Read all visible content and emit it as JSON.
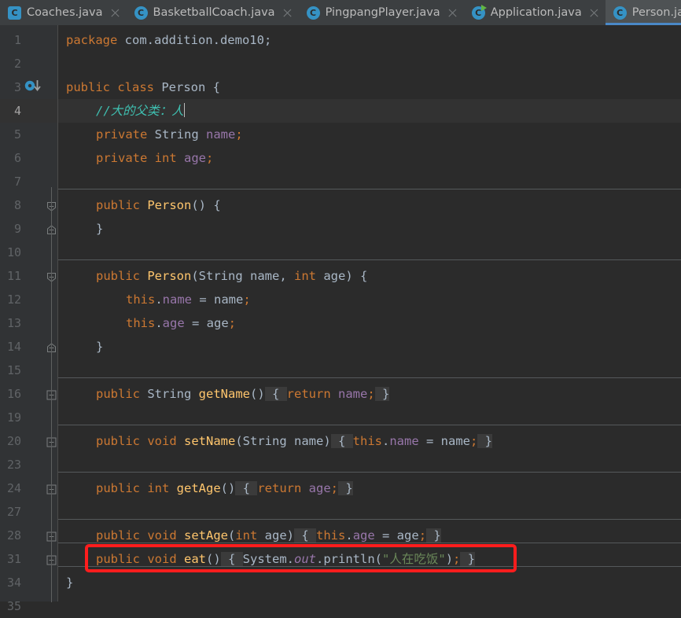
{
  "window": {
    "app": "IntelliJ IDEA",
    "accent_blue": "#4A88C7",
    "tab_icon_blue": "#3592C4",
    "run_arrow_green": "#62B543",
    "annotation_red": "#FF1D1D",
    "editor_bg": "#2B2B2B",
    "gutter_bg": "#313335",
    "tabbar_bg": "#3C3F41"
  },
  "tabs": [
    {
      "label": "Coaches.java",
      "icon": "java-class-icon",
      "active": false,
      "runnable": false,
      "closable": true
    },
    {
      "label": "BasketballCoach.java",
      "icon": "java-class-icon",
      "active": false,
      "runnable": false,
      "closable": true
    },
    {
      "label": "PingpangPlayer.java",
      "icon": "java-class-icon",
      "active": false,
      "runnable": false,
      "closable": true
    },
    {
      "label": "Application.java",
      "icon": "java-runnable-class-icon",
      "active": false,
      "runnable": true,
      "closable": true
    },
    {
      "label": "Person.java",
      "icon": "java-class-icon",
      "active": true,
      "runnable": false,
      "closable": false
    }
  ],
  "editor": {
    "language": "java",
    "current_line": 4,
    "caret_line": 4,
    "lines": [
      {
        "num": "1",
        "indent": 0,
        "tokens": [
          {
            "t": "package ",
            "c": "kw"
          },
          {
            "t": "com.addition.demo10;",
            "c": "id"
          }
        ]
      },
      {
        "num": "2",
        "indent": 0,
        "tokens": []
      },
      {
        "num": "3",
        "indent": 0,
        "gutter": "implemented-icon",
        "tokens": [
          {
            "t": "public ",
            "c": "kw"
          },
          {
            "t": "class ",
            "c": "kw"
          },
          {
            "t": "Person ",
            "c": "id"
          },
          {
            "t": "{",
            "c": "id"
          }
        ]
      },
      {
        "num": "4",
        "indent": 1,
        "current": true,
        "caret": true,
        "tokens": [
          {
            "t": "//大的父类：人",
            "c": "cmt2"
          }
        ]
      },
      {
        "num": "5",
        "indent": 1,
        "tokens": [
          {
            "t": "private ",
            "c": "kw"
          },
          {
            "t": "String ",
            "c": "id"
          },
          {
            "t": "name",
            "c": "fld"
          },
          {
            "t": ";",
            "c": "kw"
          }
        ]
      },
      {
        "num": "6",
        "indent": 1,
        "tokens": [
          {
            "t": "private ",
            "c": "kw"
          },
          {
            "t": "int ",
            "c": "kw"
          },
          {
            "t": "age",
            "c": "fld"
          },
          {
            "t": ";",
            "c": "kw"
          }
        ]
      },
      {
        "num": "7",
        "indent": 0,
        "tokens": []
      },
      {
        "num": "8",
        "indent": 1,
        "separator_above": true,
        "gutter": "fold-down",
        "tokens": [
          {
            "t": "public ",
            "c": "kw"
          },
          {
            "t": "Person",
            "c": "mth"
          },
          {
            "t": "() {",
            "c": "id"
          }
        ]
      },
      {
        "num": "9",
        "indent": 1,
        "gutter": "fold-up",
        "tokens": [
          {
            "t": "}",
            "c": "id"
          }
        ]
      },
      {
        "num": "10",
        "indent": 0,
        "tokens": []
      },
      {
        "num": "11",
        "indent": 1,
        "separator_above": true,
        "gutter": "fold-down",
        "tokens": [
          {
            "t": "public ",
            "c": "kw"
          },
          {
            "t": "Person",
            "c": "mth"
          },
          {
            "t": "(",
            "c": "id"
          },
          {
            "t": "String ",
            "c": "id"
          },
          {
            "t": "name",
            "c": "id"
          },
          {
            "t": ", ",
            "c": "id"
          },
          {
            "t": "int ",
            "c": "kw"
          },
          {
            "t": "age",
            "c": "id"
          },
          {
            "t": ") {",
            "c": "id"
          }
        ]
      },
      {
        "num": "12",
        "indent": 2,
        "tokens": [
          {
            "t": "this",
            "c": "kw"
          },
          {
            "t": ".",
            "c": "id"
          },
          {
            "t": "name",
            "c": "fld"
          },
          {
            "t": " = name",
            "c": "id"
          },
          {
            "t": ";",
            "c": "kw"
          }
        ]
      },
      {
        "num": "13",
        "indent": 2,
        "tokens": [
          {
            "t": "this",
            "c": "kw"
          },
          {
            "t": ".",
            "c": "id"
          },
          {
            "t": "age",
            "c": "fld"
          },
          {
            "t": " = age",
            "c": "id"
          },
          {
            "t": ";",
            "c": "kw"
          }
        ]
      },
      {
        "num": "14",
        "indent": 1,
        "gutter": "fold-up",
        "tokens": [
          {
            "t": "}",
            "c": "id"
          }
        ]
      },
      {
        "num": "15",
        "indent": 0,
        "tokens": []
      },
      {
        "num": "16",
        "indent": 1,
        "separator_above": true,
        "gutter": "fold-plus",
        "folded": true,
        "tokens": [
          {
            "t": "public ",
            "c": "kw"
          },
          {
            "t": "String ",
            "c": "id"
          },
          {
            "t": "getName",
            "c": "mth"
          },
          {
            "t": "()",
            "c": "id"
          },
          {
            "t": " { ",
            "c": "fold"
          },
          {
            "t": "return ",
            "c": "kw"
          },
          {
            "t": "name",
            "c": "fld"
          },
          {
            "t": ";",
            "c": "kw"
          },
          {
            "t": " }",
            "c": "fold"
          }
        ]
      },
      {
        "num": "19",
        "indent": 0,
        "tokens": []
      },
      {
        "num": "20",
        "indent": 1,
        "separator_above": true,
        "gutter": "fold-plus",
        "folded": true,
        "tokens": [
          {
            "t": "public ",
            "c": "kw"
          },
          {
            "t": "void ",
            "c": "kw"
          },
          {
            "t": "setName",
            "c": "mth"
          },
          {
            "t": "(",
            "c": "id"
          },
          {
            "t": "String ",
            "c": "id"
          },
          {
            "t": "name",
            "c": "id"
          },
          {
            "t": ")",
            "c": "id"
          },
          {
            "t": " { ",
            "c": "fold"
          },
          {
            "t": "this",
            "c": "kw"
          },
          {
            "t": ".",
            "c": "id"
          },
          {
            "t": "name",
            "c": "fld"
          },
          {
            "t": " = name",
            "c": "id"
          },
          {
            "t": ";",
            "c": "kw"
          },
          {
            "t": " }",
            "c": "fold"
          }
        ]
      },
      {
        "num": "23",
        "indent": 0,
        "tokens": []
      },
      {
        "num": "24",
        "indent": 1,
        "separator_above": true,
        "gutter": "fold-plus",
        "folded": true,
        "tokens": [
          {
            "t": "public ",
            "c": "kw"
          },
          {
            "t": "int ",
            "c": "kw"
          },
          {
            "t": "getAge",
            "c": "mth"
          },
          {
            "t": "()",
            "c": "id"
          },
          {
            "t": " { ",
            "c": "fold"
          },
          {
            "t": "return ",
            "c": "kw"
          },
          {
            "t": "age",
            "c": "fld"
          },
          {
            "t": ";",
            "c": "kw"
          },
          {
            "t": " }",
            "c": "fold"
          }
        ]
      },
      {
        "num": "27",
        "indent": 0,
        "tokens": []
      },
      {
        "num": "28",
        "indent": 1,
        "separator_above": true,
        "gutter": "fold-plus",
        "folded": true,
        "tokens": [
          {
            "t": "public ",
            "c": "kw"
          },
          {
            "t": "void ",
            "c": "kw"
          },
          {
            "t": "setAge",
            "c": "mth"
          },
          {
            "t": "(",
            "c": "id"
          },
          {
            "t": "int ",
            "c": "kw"
          },
          {
            "t": "age",
            "c": "id"
          },
          {
            "t": ")",
            "c": "id"
          },
          {
            "t": " { ",
            "c": "fold"
          },
          {
            "t": "this",
            "c": "kw"
          },
          {
            "t": ".",
            "c": "id"
          },
          {
            "t": "age",
            "c": "fld"
          },
          {
            "t": " = age",
            "c": "id"
          },
          {
            "t": ";",
            "c": "kw"
          },
          {
            "t": " }",
            "c": "fold"
          }
        ]
      },
      {
        "num": "31",
        "indent": 1,
        "separator_above": true,
        "gutter": "fold-plus",
        "folded": true,
        "highlighted": true,
        "tokens": [
          {
            "t": "public ",
            "c": "kw"
          },
          {
            "t": "void ",
            "c": "kw"
          },
          {
            "t": "eat",
            "c": "mth"
          },
          {
            "t": "()",
            "c": "id"
          },
          {
            "t": " { ",
            "c": "fold"
          },
          {
            "t": "System",
            "c": "id"
          },
          {
            "t": ".",
            "c": "id"
          },
          {
            "t": "out",
            "c": "stat"
          },
          {
            "t": ".println(",
            "c": "id"
          },
          {
            "t": "\"人在吃饭\"",
            "c": "str"
          },
          {
            "t": ")",
            "c": "id"
          },
          {
            "t": ";",
            "c": "kw"
          },
          {
            "t": " }",
            "c": "fold"
          }
        ]
      },
      {
        "num": "34",
        "indent": 0,
        "separator_above": true,
        "tokens": [
          {
            "t": "}",
            "c": "id"
          }
        ]
      },
      {
        "num": "35",
        "indent": 0,
        "tokens": []
      }
    ],
    "annotation": {
      "type": "red-rectangle",
      "target_line": "31",
      "color": "#FF1D1D"
    }
  }
}
